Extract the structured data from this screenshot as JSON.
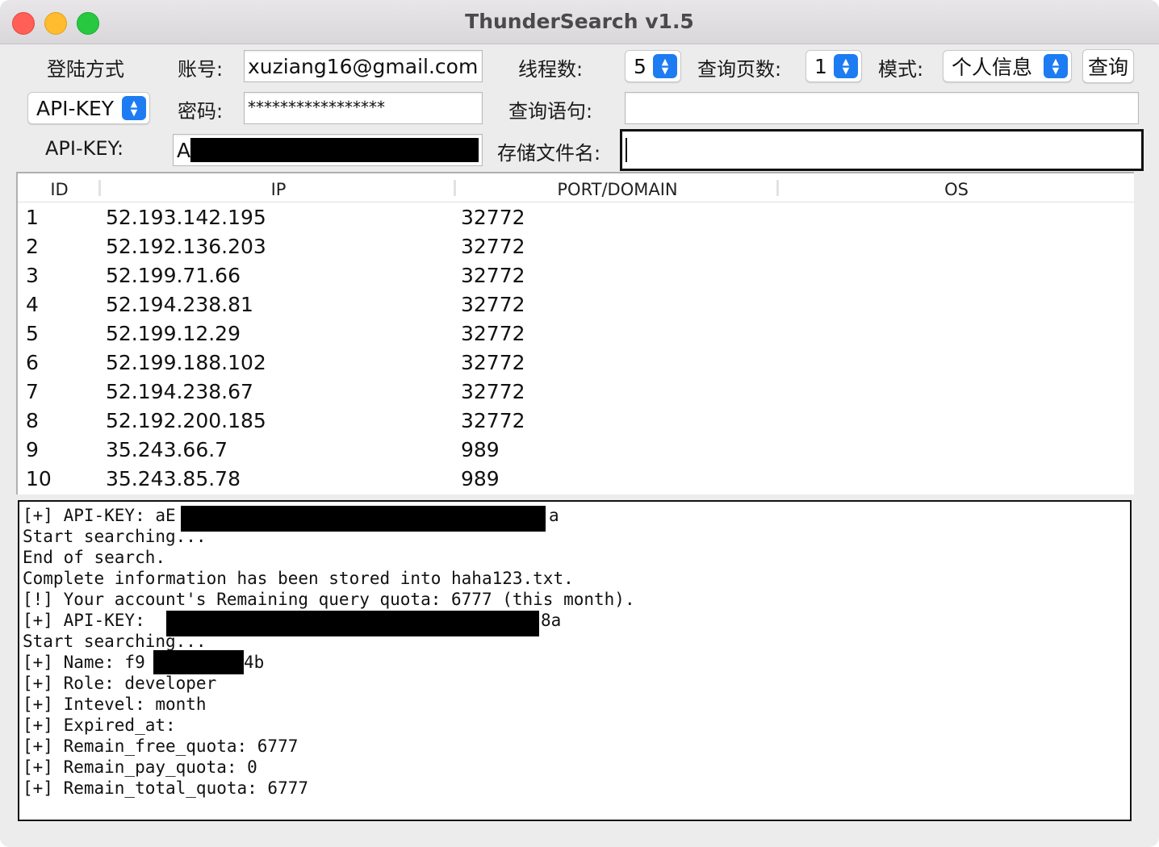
{
  "window": {
    "title": "ThunderSearch v1.5"
  },
  "form": {
    "login_method_label": "登陆方式",
    "login_method_value": "API-KEY",
    "account_label": "账号:",
    "account_value": "xuziang16@gmail.com",
    "password_label": "密码:",
    "password_value": "*****************",
    "apikey_label": "API-KEY:",
    "apikey_value_visible": "A",
    "threads_label": "线程数:",
    "threads_value": "5",
    "pages_label": "查询页数:",
    "pages_value": "1",
    "mode_label": "模式:",
    "mode_value": "个人信息",
    "query_button": "查询",
    "query_label": "查询语句:",
    "query_value": "",
    "file_label": "存储文件名:",
    "file_value": ""
  },
  "table": {
    "columns": [
      "ID",
      "IP",
      "PORT/DOMAIN",
      "OS"
    ],
    "rows": [
      {
        "id": "1",
        "ip": "52.193.142.195",
        "port": "32772",
        "os": ""
      },
      {
        "id": "2",
        "ip": "52.192.136.203",
        "port": "32772",
        "os": ""
      },
      {
        "id": "3",
        "ip": "52.199.71.66",
        "port": "32772",
        "os": ""
      },
      {
        "id": "4",
        "ip": "52.194.238.81",
        "port": "32772",
        "os": ""
      },
      {
        "id": "5",
        "ip": "52.199.12.29",
        "port": "32772",
        "os": ""
      },
      {
        "id": "6",
        "ip": "52.199.188.102",
        "port": "32772",
        "os": ""
      },
      {
        "id": "7",
        "ip": "52.194.238.67",
        "port": "32772",
        "os": ""
      },
      {
        "id": "8",
        "ip": "52.192.200.185",
        "port": "32772",
        "os": ""
      },
      {
        "id": "9",
        "ip": "35.243.66.7",
        "port": "989",
        "os": ""
      },
      {
        "id": "10",
        "ip": "35.243.85.78",
        "port": "989",
        "os": ""
      }
    ]
  },
  "console": {
    "line1_prefix": "[+] API-KEY: aE",
    "line1_suffix": "a",
    "line2": "Start searching...",
    "line3": "End of search.",
    "line4": "Complete information has been stored into haha123.txt.",
    "line5": "[!] Your account's Remaining query quota: 6777 (this month).",
    "line6_prefix": "[+] API-KEY: ",
    "line6_suffix": "8a",
    "line7": "Start searching...",
    "line8_prefix": "[+] Name: f9",
    "line8_suffix": "4b",
    "line9": "[+] Role: developer",
    "line10": "[+] Intevel: month",
    "line11": "[+] Expired_at:",
    "line12": "[+] Remain_free_quota: 6777",
    "line13": "[+] Remain_pay_quota: 0",
    "line14": "[+] Remain_total_quota: 6777"
  }
}
